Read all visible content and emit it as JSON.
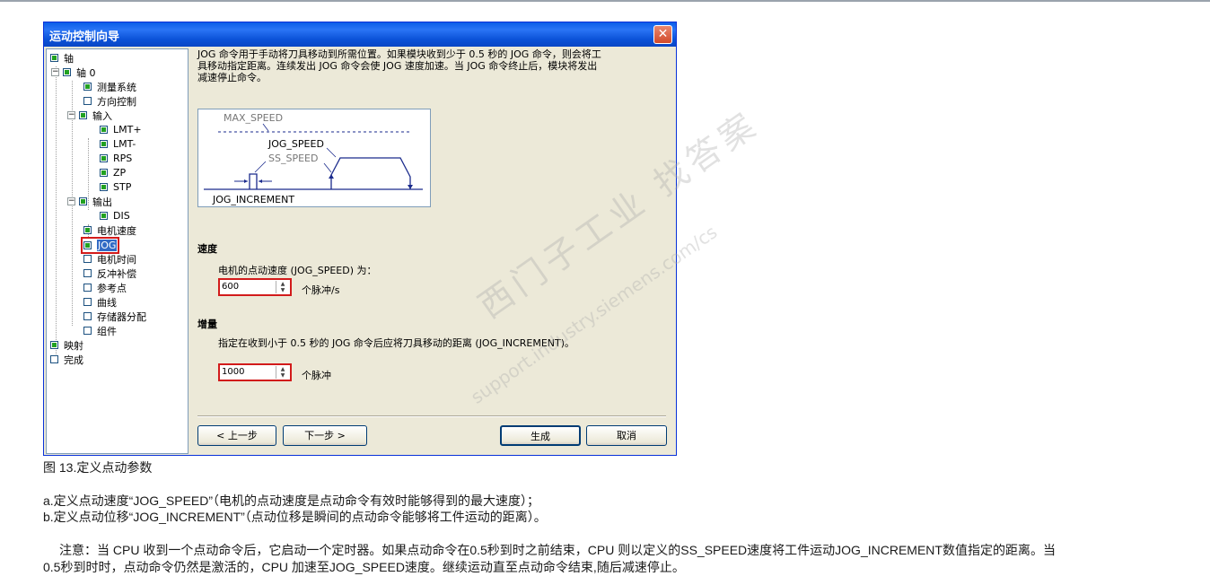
{
  "window": {
    "title": "运动控制向导",
    "close": "✕"
  },
  "tree": {
    "root1": "轴",
    "axis0": "轴 0",
    "measure": "测量系统",
    "direction": "方向控制",
    "input": "输入",
    "lmt_plus": "LMT+",
    "lmt_minus": "LMT-",
    "rps": "RPS",
    "zp": "ZP",
    "stp": "STP",
    "output": "输出",
    "dis": "DIS",
    "motor_speed": "电机速度",
    "jog": "JOG",
    "motor_time": "电机时间",
    "backlash": "反冲补偿",
    "ref_point": "参考点",
    "curve": "曲线",
    "memory": "存储器分配",
    "component": "组件",
    "mapping": "映射",
    "finish": "完成"
  },
  "desc": {
    "line1": "JOG 命令用于手动将刀具移动到所需位置。如果模块收到少于 0.5 秒的 JOG 命令，则会将工",
    "line2": "具移动指定距离。连续发出 JOG 命令会使 JOG 速度加速。当 JOG 命令终止后，模块将发出",
    "line3": "减速停止命令。"
  },
  "diagram": {
    "max_speed": "MAX_SPEED",
    "jog_speed": "JOG_SPEED",
    "ss_speed": "SS_SPEED",
    "jog_increment": "JOG_INCREMENT"
  },
  "speed": {
    "title": "速度",
    "label": "电机的点动速度 (JOG_SPEED) 为：",
    "value": "600",
    "unit": "个脉冲/s"
  },
  "increment": {
    "title": "增量",
    "label": "指定在收到小于 0.5 秒的 JOG 命令后应将刀具移动的距离 (JOG_INCREMENT)。",
    "value": "1000",
    "unit": "个脉冲"
  },
  "buttons": {
    "prev": "< 上一步",
    "next": "下一步 >",
    "generate": "生成",
    "cancel": "取消"
  },
  "watermark": {
    "big": "西门子工业 找答案",
    "small": "support.industry.siemens.com/cs"
  },
  "page": {
    "caption": "图 13.定义点动参数",
    "item_a": "a.定义点动速度“JOG_SPEED”（电机的点动速度是点动命令有效时能够得到的最大速度）；",
    "item_b": "b.定义点动位移“JOG_INCREMENT”（点动位移是瞬间的点动命令能够将工件运动的距离）。",
    "note1": "注意：当 CPU 收到一个点动命令后，它启动一个定时器。如果点动命令在0.5秒到时之前结束，CPU 则以定义的SS_SPEED速度将工件运动JOG_INCREMENT数值指定的距离。当",
    "note2": "0.5秒到时时，点动命令仍然是激活的，CPU 加速至JOG_SPEED速度。继续运动直至点动命令结束,随后减速停止。"
  }
}
